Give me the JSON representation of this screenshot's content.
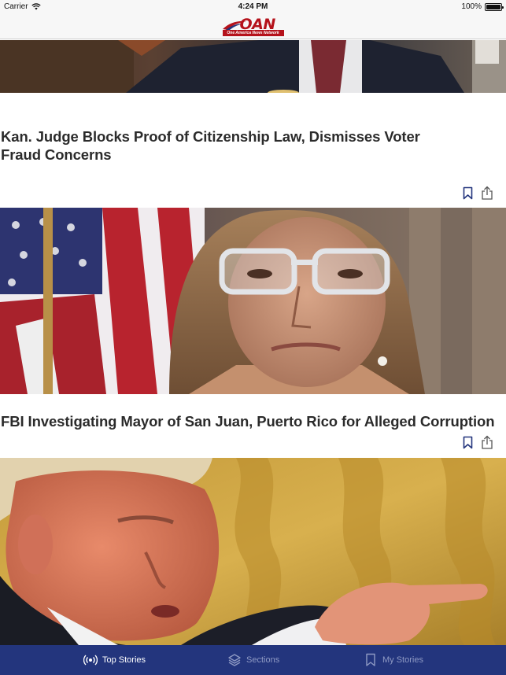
{
  "status_bar": {
    "carrier": "Carrier",
    "time": "4:24 PM",
    "battery": "100%"
  },
  "header": {
    "logo_text": "OAN",
    "logo_tagline": "One America News Network",
    "brand_color": "#b5121b"
  },
  "feed": {
    "articles": [
      {
        "headline_line1": "Kan. Judge Blocks Proof of Citizenship Law, Dismisses Voter",
        "headline_line2": "Fraud Concerns"
      },
      {
        "headline_line1": "FBI Investigating Mayor of San Juan, Puerto Rico for Alleged Corruption"
      }
    ]
  },
  "tab_bar": {
    "background": "#23357d",
    "tabs": [
      {
        "label": "Top Stories",
        "icon": "broadcast-icon",
        "active": true
      },
      {
        "label": "Sections",
        "icon": "layers-icon",
        "active": false
      },
      {
        "label": "My Stories",
        "icon": "bookmark-icon",
        "active": false
      }
    ]
  }
}
